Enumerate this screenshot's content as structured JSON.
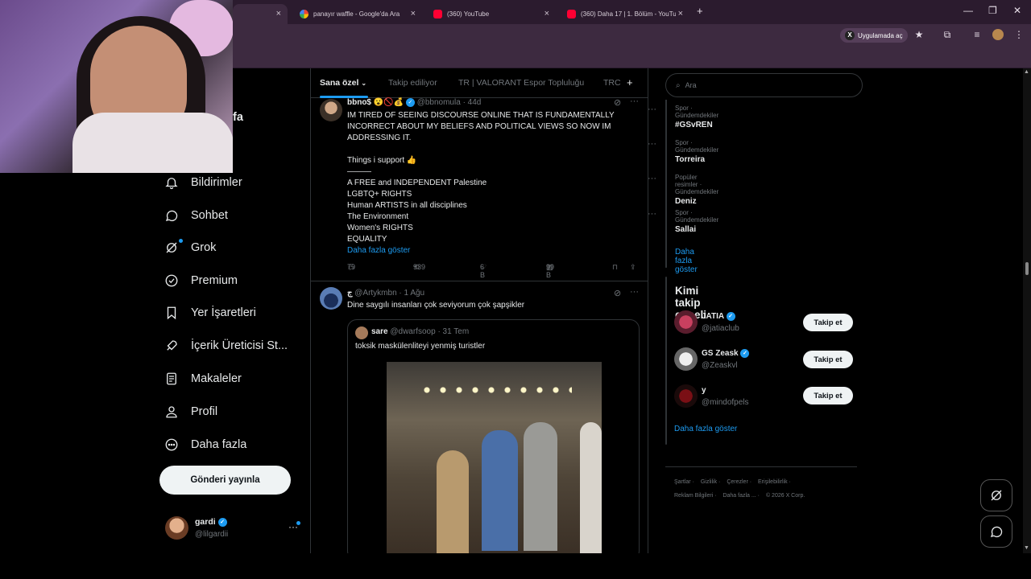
{
  "browser": {
    "tabs": [
      {
        "label": "panayır waffle - Google'da Ara",
        "favicon": "google-icon"
      },
      {
        "label": "(360) YouTube",
        "favicon": "youtube-icon"
      },
      {
        "label": "(360) Daha 17 | 1. Bölüm - YouTube",
        "favicon": "youtube-icon"
      }
    ],
    "new_tab": "+",
    "open_in_app": "Uygulamada aç",
    "win_min": "—",
    "win_max": "❐",
    "win_close": "✕",
    "tab_close": "×"
  },
  "sidebar": {
    "partial_label": "fa",
    "items": [
      {
        "label": "Bildirimler",
        "icon": "bell-icon"
      },
      {
        "label": "Sohbet",
        "icon": "chat-icon"
      },
      {
        "label": "Grok",
        "icon": "grok-icon"
      },
      {
        "label": "Premium",
        "icon": "verified-badge-icon"
      },
      {
        "label": "Yer İşaretleri",
        "icon": "bookmark-icon"
      },
      {
        "label": "İçerik Üreticisi St...",
        "icon": "rocket-icon"
      },
      {
        "label": "Makaleler",
        "icon": "article-icon"
      },
      {
        "label": "Profil",
        "icon": "person-icon"
      },
      {
        "label": "Daha fazla",
        "icon": "more-circle-icon"
      }
    ],
    "post_button": "Gönderi yayınla",
    "account": {
      "name": "gardi",
      "handle": "@lilgardii",
      "more": "···"
    }
  },
  "feed": {
    "tabs": [
      "Sana özel",
      "Takip ediliyor",
      "TR | VALORANT Espor Topluluğu",
      "TRC"
    ],
    "add_tab": "+",
    "tweets": [
      {
        "name": "bbno$",
        "emoji": "😮🚫💰",
        "handle": "@bbnomula",
        "time": "· 44d",
        "lines": [
          "IM TIRED OF SEEING DISCOURSE ONLINE THAT IS FUNDAMENTALLY",
          "INCORRECT ABOUT MY BELIEFS AND POLITICAL VIEWS SO NOW IM",
          "ADDRESSING IT.",
          "",
          "Things i support 👍",
          "———",
          "A FREE and INDEPENDENT Palestine",
          "LGBTQ+ RIGHTS",
          "Human ARTISTS in all disciplines",
          "The Environment",
          "Women's RIGHTS",
          "EQUALITY"
        ],
        "show_more": "Daha fazla göster",
        "replies": "79",
        "reposts": "939",
        "likes": "6 B",
        "views": "99 B"
      },
      {
        "name": "ج",
        "handle": "@Artykmbn",
        "time": "· 1 Ağu",
        "text": "Dine saygılı insanları çok seviyorum çok şapşikler",
        "quote": {
          "name": "sare",
          "handle": "@dwarfsoop",
          "time": "· 31 Tem",
          "text": "toksik maskülenliteyi yenmiş turistler"
        }
      }
    ]
  },
  "right": {
    "search_placeholder": "Ara",
    "trends": [
      {
        "context": "Spor · Gündemdekiler",
        "name": "#GSvREN"
      },
      {
        "context": "Spor · Gündemdekiler",
        "name": "Torreira"
      },
      {
        "context": "Popüler resimler · Gündemdekiler",
        "name": "Deniz"
      },
      {
        "context": "Spor · Gündemdekiler",
        "name": "Sallai"
      }
    ],
    "trends_more": "Daha fazla göster",
    "who_to_follow": {
      "title": "Kimi takip etmeli",
      "users": [
        {
          "name": "JATIA",
          "handle": "@jatiaclub",
          "button": "Takip et"
        },
        {
          "name": "GS Zeask",
          "handle": "@Zeaskvl",
          "button": "Takip et"
        },
        {
          "name": "y",
          "handle": "@mindofpels",
          "button": "Takip et"
        }
      ],
      "more": "Daha fazla göster"
    },
    "footer": {
      "line1": [
        "Şartlar",
        "Gizlilik",
        "Çerezler",
        "Erişilebilirlik"
      ],
      "line2": [
        "Reklam Bilgileri",
        "Daha fazla ...",
        "© 2026 X Corp."
      ]
    }
  },
  "colors": {
    "accent": "#1d9bf0",
    "chrome": "#3d2a40",
    "background": "#000000"
  }
}
